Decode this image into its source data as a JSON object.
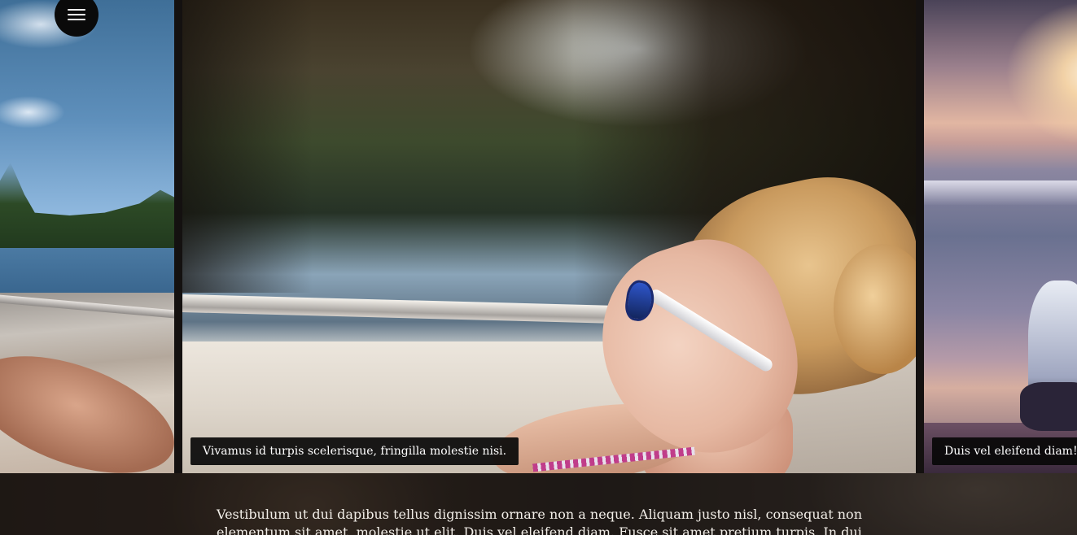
{
  "slider": {
    "slides": [
      {
        "id": "left",
        "caption": ""
      },
      {
        "id": "center",
        "caption": "Vivamus id turpis scelerisque, fringilla molestie nisi."
      },
      {
        "id": "right",
        "caption": "Duis vel eleifend diam!"
      }
    ]
  },
  "menu": {
    "icon": "hamburger-menu-icon"
  },
  "content": {
    "paragraph": "Vestibulum ut dui dapibus tellus dignissim ornare non a neque. Aliquam justo nisl, consequat non elementum sit amet, molestie ut elit. Duis vel eleifend diam. Fusce sit amet pretium turpis. In dui sapien"
  }
}
